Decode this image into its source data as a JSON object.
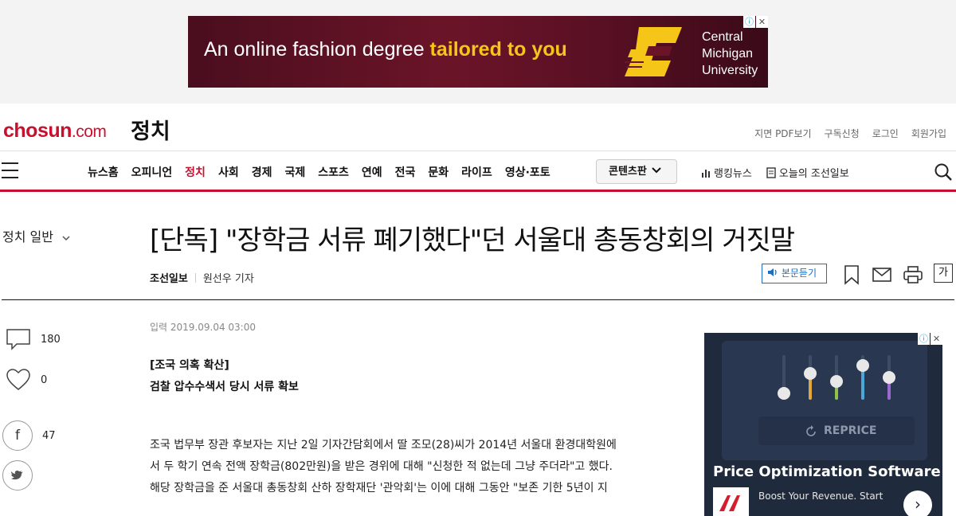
{
  "top_ad": {
    "text_plain": "An online fashion degree ",
    "text_highlight": "tailored to you",
    "brand_line1": "Central",
    "brand_line2": "Michigan",
    "brand_line3": "University",
    "colors": {
      "background": "#5a1024",
      "highlight": "#f5c518"
    }
  },
  "header": {
    "brand_main": "chosun",
    "brand_suffix": ".com",
    "section": "정치",
    "util_links": [
      "지면 PDF보기",
      "구독신청",
      "로그인",
      "회원가입"
    ],
    "accent": "#c8102e"
  },
  "nav": {
    "items": [
      "뉴스홈",
      "오피니언",
      "정치",
      "사회",
      "경제",
      "국제",
      "스포츠",
      "연예",
      "전국",
      "문화",
      "라이프",
      "영상·포토"
    ],
    "active": "정치",
    "content_button": "콘텐츠판",
    "ranking": "랭킹뉴스",
    "today_paper": "오늘의 조선일보"
  },
  "article": {
    "subsection": "정치 일반",
    "headline": "[단독] \"장학금 서류 폐기했다\"던 서울대 총동창회의 거짓말",
    "press": "조선일보",
    "reporter": "원선우 기자",
    "listen_label": "본문듣기",
    "font_label": "가",
    "date": "입력 2019.09.04 03:00",
    "kicker1": "[조국 의혹 확산]",
    "kicker2": "검찰 압수수색서 당시 서류 확보",
    "body_lines": [
      "조국 법무부 장관 후보자는 지난 2일 기자간담회에서 딸 조모(28)씨가 2014년 서울대 환경대학원에",
      "서 두 학기 연속 전액 장학금(802만원)을 받은 경위에 대해 \"신청한 적 없는데 그냥 주더라\"고 했다.",
      "해당 장학금을 준 서울대 총동창회 산하 장학재단 '관악회'는 이에 대해 그동안 \"보존 기한 5년이 지"
    ]
  },
  "social": {
    "comments": "180",
    "likes": "0",
    "facebook": "47"
  },
  "side_ad": {
    "button": "REPRICE",
    "title": "Price Optimization Software",
    "subtitle": "Boost Your Revenue. Start"
  }
}
